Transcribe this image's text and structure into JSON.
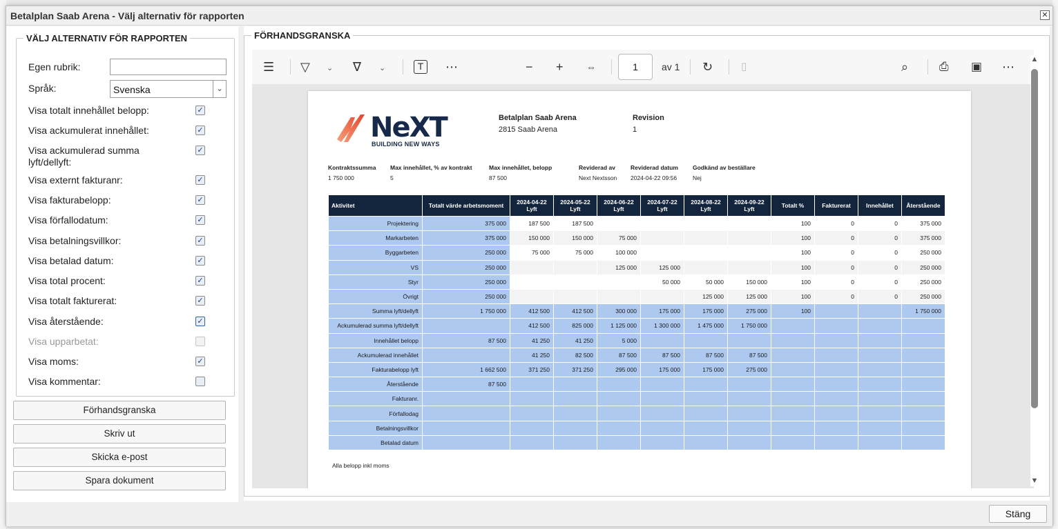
{
  "window": {
    "title": "Betalplan Saab Arena - Välj alternativ för rapporten"
  },
  "options": {
    "legend": "VÄLJ ALTERNATIV FÖR RAPPORTEN",
    "custom_heading_label": "Egen rubrik:",
    "custom_heading_value": "",
    "language_label": "Språk:",
    "language_value": "Svenska",
    "checkboxes": [
      {
        "label": "Visa totalt innehållet belopp:",
        "checked": true
      },
      {
        "label": "Visa ackumulerat innehållet:",
        "checked": true
      },
      {
        "label": "Visa ackumulerad summa lyft/dellyft:",
        "checked": true
      },
      {
        "label": "Visa externt fakturanr:",
        "checked": true
      },
      {
        "label": "Visa fakturabelopp:",
        "checked": true
      },
      {
        "label": "Visa förfallodatum:",
        "checked": true
      },
      {
        "label": "Visa betalningsvillkor:",
        "checked": true
      },
      {
        "label": "Visa betalad datum:",
        "checked": true
      },
      {
        "label": "Visa total procent:",
        "checked": true
      },
      {
        "label": "Visa totalt fakturerat:",
        "checked": true
      },
      {
        "label": "Visa återstående:",
        "checked": true
      },
      {
        "label": "Visa upparbetat:",
        "checked": false,
        "disabled": true
      },
      {
        "label": "Visa moms:",
        "checked": true
      },
      {
        "label": "Visa kommentar:",
        "checked": false
      }
    ]
  },
  "actions": {
    "preview": "Förhandsgranska",
    "print": "Skriv ut",
    "email": "Skicka e-post",
    "save": "Spara dokument"
  },
  "preview": {
    "legend": "FÖRHANDSGRANSKA",
    "toolbar": {
      "page_current": "1",
      "page_of": "av 1"
    },
    "doc": {
      "logo_text": "NeXT",
      "logo_sub": "BUILDING NEW WAYS",
      "plan_title": "Betalplan Saab Arena",
      "plan_sub": "2815 Saab Arena",
      "revision_label": "Revision",
      "revision_value": "1",
      "meta": [
        {
          "label": "Kontraktssumma",
          "value": "1 750 000"
        },
        {
          "label": "Max innehållet, % av kontrakt",
          "value": "5"
        },
        {
          "label": "Max innehållet, belopp",
          "value": "87 500"
        },
        {
          "label": "Reviderad av",
          "value": "Next Nextsson"
        },
        {
          "label": "Reviderad datum",
          "value": "2024-04-22 09:56"
        },
        {
          "label": "Godkänd av beställare",
          "value": "Nej"
        }
      ],
      "table": {
        "headers": [
          "Aktivitet",
          "Totalt värde arbetsmoment",
          "2024-04-22\nLyft",
          "2024-05-22\nLyft",
          "2024-06-22\nLyft",
          "2024-07-22\nLyft",
          "2024-08-22\nLyft",
          "2024-09-22\nLyft",
          "Totalt %",
          "Fakturerat",
          "Innehållet",
          "Återstående"
        ],
        "rows": [
          [
            "Projektering",
            "375 000",
            "187 500",
            "187 500",
            "",
            "",
            "",
            "",
            "100",
            "0",
            "0",
            "375 000"
          ],
          [
            "Markarbeten",
            "375 000",
            "150 000",
            "150 000",
            "75 000",
            "",
            "",
            "",
            "100",
            "0",
            "0",
            "375 000"
          ],
          [
            "Byggarbeten",
            "250 000",
            "75 000",
            "75 000",
            "100 000",
            "",
            "",
            "",
            "100",
            "0",
            "0",
            "250 000"
          ],
          [
            "VS",
            "250 000",
            "",
            "",
            "125 000",
            "125 000",
            "",
            "",
            "100",
            "0",
            "0",
            "250 000"
          ],
          [
            "Styr",
            "250 000",
            "",
            "",
            "",
            "50 000",
            "50 000",
            "150 000",
            "100",
            "0",
            "0",
            "250 000"
          ],
          [
            "Övrigt",
            "250 000",
            "",
            "",
            "",
            "",
            "125 000",
            "125 000",
            "100",
            "0",
            "0",
            "250 000"
          ],
          [
            "Summa lyft/dellyft",
            "1 750 000",
            "412 500",
            "412 500",
            "300 000",
            "175 000",
            "175 000",
            "275 000",
            "100",
            "",
            "",
            "1 750 000"
          ],
          [
            "Ackumulerad summa lyft/dellyft",
            "",
            "412 500",
            "825 000",
            "1 125 000",
            "1 300 000",
            "1 475 000",
            "1 750 000",
            "",
            "",
            "",
            ""
          ],
          [
            "Innehållet belopp",
            "87 500",
            "41 250",
            "41 250",
            "5 000",
            "",
            "",
            "",
            "",
            "",
            "",
            ""
          ],
          [
            "Ackumulerad innehållet",
            "",
            "41 250",
            "82 500",
            "87 500",
            "87 500",
            "87 500",
            "87 500",
            "",
            "",
            "",
            ""
          ],
          [
            "Fakturabelopp lyft",
            "1 662 500",
            "371 250",
            "371 250",
            "295 000",
            "175 000",
            "175 000",
            "275 000",
            "",
            "",
            "",
            ""
          ],
          [
            "Återstående",
            "87 500",
            "",
            "",
            "",
            "",
            "",
            "",
            "",
            "",
            "",
            ""
          ],
          [
            "Fakturanr.",
            "",
            "",
            "",
            "",
            "",
            "",
            "",
            "",
            "",
            "",
            ""
          ],
          [
            "Förfallodag",
            "",
            "",
            "",
            "",
            "",
            "",
            "",
            "",
            "",
            "",
            ""
          ],
          [
            "Betalningsvillkor",
            "",
            "",
            "",
            "",
            "",
            "",
            "",
            "",
            "",
            "",
            ""
          ],
          [
            "Betalad datum",
            "",
            "",
            "",
            "",
            "",
            "",
            "",
            "",
            "",
            "",
            ""
          ]
        ]
      },
      "footnote": "Alla belopp inkl moms"
    }
  },
  "footer": {
    "close": "Stäng"
  }
}
